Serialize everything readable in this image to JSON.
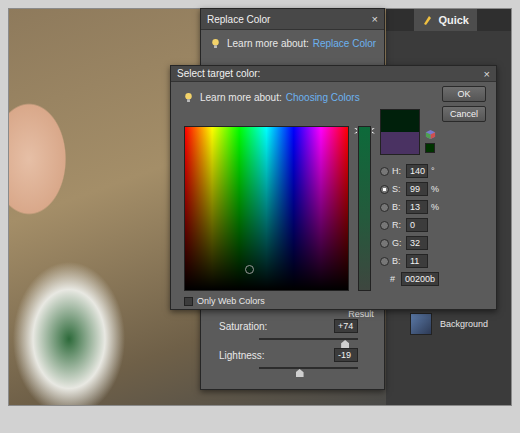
{
  "workspace": {
    "tabs": [
      {
        "label": "Quick",
        "selected": true
      }
    ],
    "layers": [
      {
        "name": "Background",
        "selected": false
      }
    ]
  },
  "replace_color": {
    "title": "Replace Color",
    "close": "×",
    "learn_prefix": "Learn more about:",
    "learn_link": "Replace Color",
    "result": {
      "label": "Result",
      "color": "#00200b"
    },
    "sliders": [
      {
        "label": "Saturation:",
        "value": "+74",
        "level": 0.87
      },
      {
        "label": "Lightness:",
        "value": "-19",
        "level": 0.41
      }
    ]
  },
  "picker": {
    "title": "Select target color:",
    "close": "×",
    "learn_prefix": "Learn more about:",
    "learn_link": "Choosing Colors",
    "buttons": [
      "OK",
      "Cancel"
    ],
    "new_color": "#00200b",
    "current_color": "#4a3262",
    "web_safe_color": "#003300",
    "field_cursor": {
      "hue_level": 0.39,
      "brightness_level": 0.13
    },
    "saturation_level": 0.99,
    "fields": [
      {
        "label": "H:",
        "value": "140",
        "unit": "°",
        "selected": false
      },
      {
        "label": "S:",
        "value": "99",
        "unit": "%",
        "selected": true
      },
      {
        "label": "B:",
        "value": "13",
        "unit": "%",
        "selected": false
      },
      {
        "label": "R:",
        "value": "0",
        "unit": "",
        "selected": false
      },
      {
        "label": "G:",
        "value": "32",
        "unit": "",
        "selected": false
      },
      {
        "label": "B:",
        "value": "11",
        "unit": "",
        "selected": false
      }
    ],
    "hex": {
      "label": "#",
      "value": "00200b"
    },
    "web_colors": {
      "label": "Only Web Colors",
      "checked": false
    }
  }
}
